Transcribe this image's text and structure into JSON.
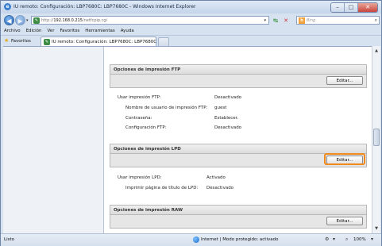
{
  "window": {
    "title": "IU remoto: Configuración: LBP7680C: LBP7680C - Windows Internet Explorer"
  },
  "address": {
    "url_prefix": "http://",
    "url_host": "192.168.0.215",
    "url_path": "/netfcpip.cgi",
    "search_placeholder": "Bing"
  },
  "menu": [
    "Archivo",
    "Edición",
    "Ver",
    "Favoritos",
    "Herramientas",
    "Ayuda"
  ],
  "favorites": {
    "label": "Favoritos",
    "tab_title": "IU remoto: Configuración: LBP7680C: LBP7680C"
  },
  "sections": {
    "ftp": {
      "header": "Opciones de impresión FTP",
      "edit_label": "Editar...",
      "rows": [
        {
          "label": "Usar impresión FTP:",
          "value": "Desactivado"
        },
        {
          "label": "Nombre de usuario de impresión FTP:",
          "value": "guest"
        },
        {
          "label": "Contraseña:",
          "value": "Establecer."
        },
        {
          "label": "Configuración FTP:",
          "value": "Desactivado"
        }
      ]
    },
    "lpd": {
      "header": "Opciones de impresión LPD",
      "edit_label": "Editar...",
      "rows": [
        {
          "label": "Usar impresión LPD:",
          "value": "Activado"
        },
        {
          "label": "Imprimir página de título de LPD:",
          "value": "Desactivado"
        }
      ]
    },
    "raw": {
      "header": "Opciones de impresión RAW",
      "edit_label": "Editar..."
    }
  },
  "status": {
    "left": "Listo",
    "zone": "Internet | Modo protegido: activado",
    "zoom": "100%"
  }
}
